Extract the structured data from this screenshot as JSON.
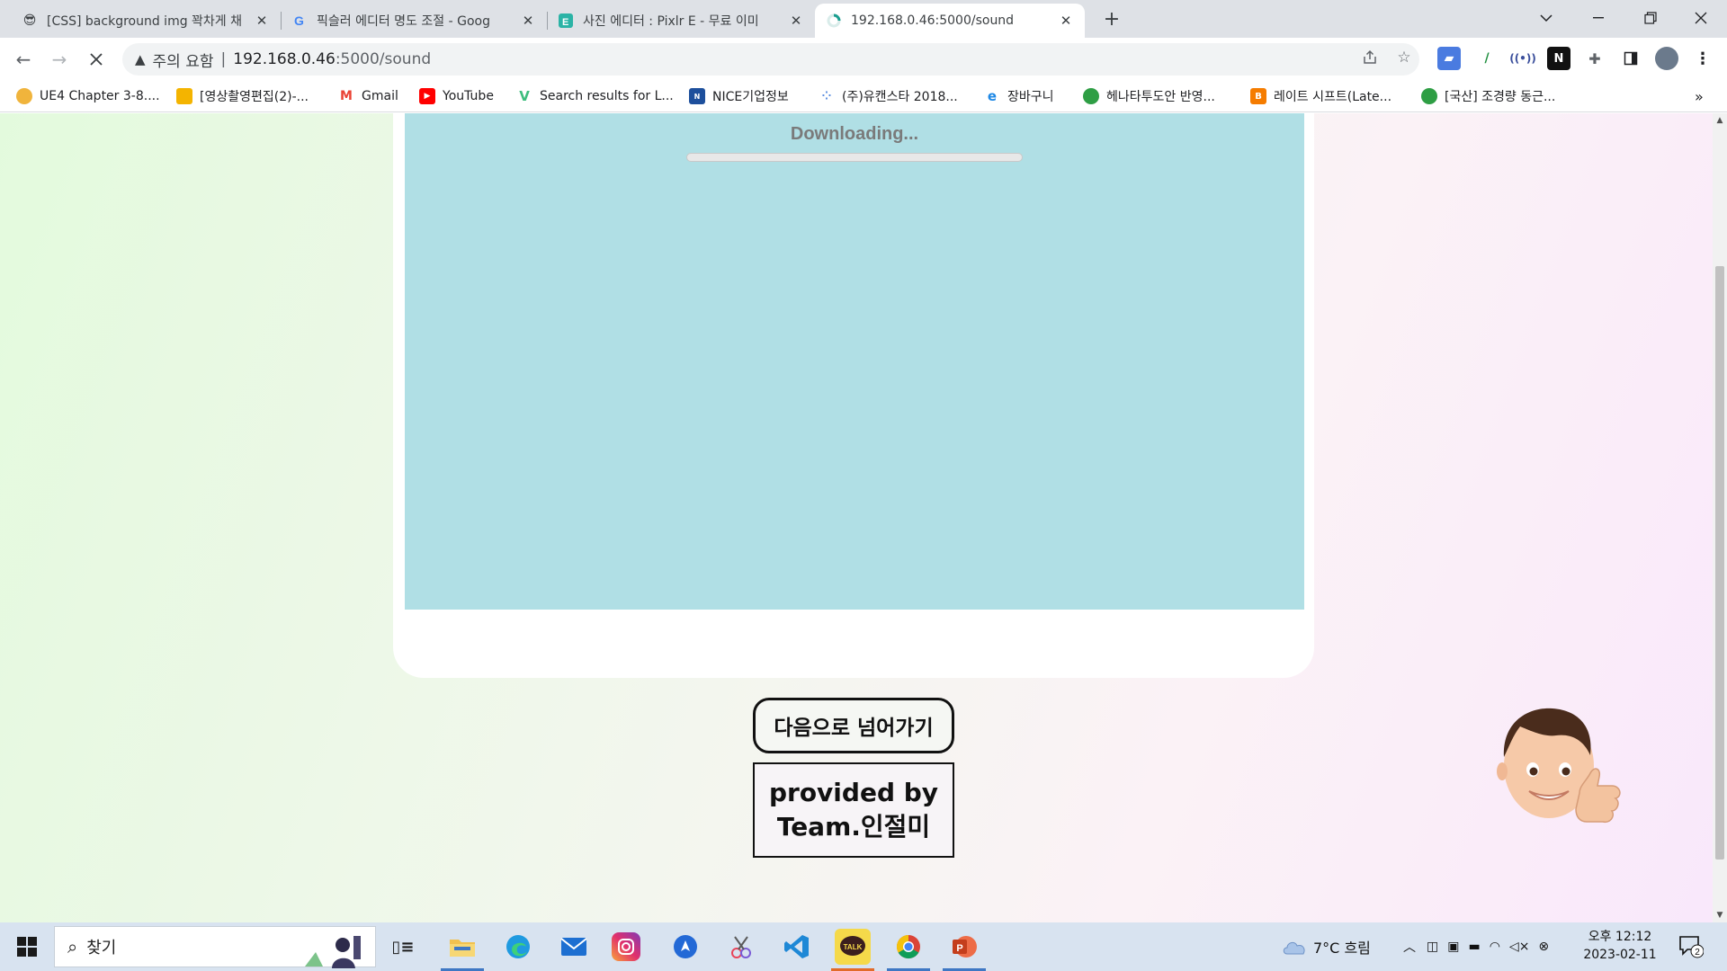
{
  "browser": {
    "tabs": [
      {
        "title": "[CSS] background img 꽉차게 채",
        "favicon": "sunglasses-emoji-icon",
        "active": false
      },
      {
        "title": "픽슬러 에디터 명도 조절 - Goog",
        "favicon": "google-icon",
        "active": false
      },
      {
        "title": "사진 에디터 : Pixlr E - 무료 이미",
        "favicon": "pixlr-icon",
        "active": false
      },
      {
        "title": "192.168.0.46:5000/sound",
        "favicon": "loading-icon",
        "active": true
      }
    ],
    "address": {
      "warning_label": "주의 요함",
      "separator": "|",
      "host": "192.168.0.46",
      "path": ":5000/sound"
    },
    "bookmarks": [
      {
        "label": "UE4 Chapter 3-8....",
        "icon": "half-moon-icon",
        "color": "#f0b43c"
      },
      {
        "label": "[영상촬영편집(2)-...",
        "icon": "classroom-icon",
        "color": "#f4b400"
      },
      {
        "label": "Gmail",
        "icon": "gmail-icon",
        "color": "#ea4335"
      },
      {
        "label": "YouTube",
        "icon": "youtube-icon",
        "color": "#ff0000"
      },
      {
        "label": "Search results for L...",
        "icon": "vee-icon",
        "color": "#3dbd7d"
      },
      {
        "label": "NICE기업정보",
        "icon": "nice-icon",
        "color": "#1d4f9c"
      },
      {
        "label": "(주)유캔스타 2018...",
        "icon": "dots-icon",
        "color": "#5a8de0"
      },
      {
        "label": "장바구니",
        "icon": "ie-icon",
        "color": "#1e88e5"
      },
      {
        "label": "헤나타투도안 반영...",
        "icon": "shield-icon",
        "color": "#2e9e44"
      },
      {
        "label": "레이트 시프트(Late...",
        "icon": "blogger-icon",
        "color": "#f57c00"
      },
      {
        "label": "[국산] 조경량 동근...",
        "icon": "shield-icon",
        "color": "#2e9e44"
      }
    ],
    "bookmarks_overflow": "»"
  },
  "page": {
    "download_label": "Downloading...",
    "download_progress": 0.0,
    "next_button": "다음으로 넘어가기",
    "credit_line1": "provided by",
    "credit_line2": "Team.인절미",
    "avatar_icon": "memoji-thumbs-up-icon"
  },
  "taskbar": {
    "search_placeholder": "찾기",
    "apps": [
      "task-view-icon",
      "file-explorer-icon",
      "edge-icon",
      "mail-icon",
      "instagram-icon",
      "arrow-app-icon",
      "snip-icon",
      "vscode-icon",
      "kakaotalk-icon",
      "chrome-icon",
      "powerpoint-icon"
    ],
    "kakao_label": "TALK",
    "weather": "7°C 흐림",
    "clock_time": "오후 12:12",
    "clock_date": "2023-02-11",
    "notification_count": "2"
  },
  "colors": {
    "player_bg": "#b0dfe5",
    "page_gradient_start": "#e3fadd",
    "page_gradient_end": "#f9e8fb",
    "tabstrip_bg": "#dee1e6",
    "taskbar_bg": "#d8e3f0"
  }
}
